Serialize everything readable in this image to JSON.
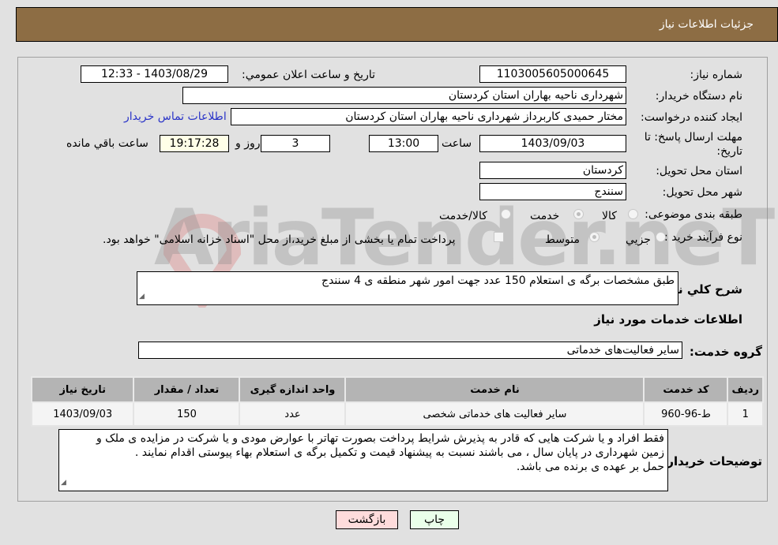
{
  "header": {
    "title": "جزئیات اطلاعات نیاز"
  },
  "fields": {
    "need_number_label": "شماره نیاز:",
    "need_number": "1103005605000645",
    "announce_label": "تاریخ و ساعت اعلان عمومي:",
    "announce_value": "1403/08/29 - 12:33",
    "buyer_org_label": "نام دستگاه خریدار:",
    "buyer_org": "شهرداری ناحیه بهاران استان کردستان",
    "requester_label": "ایجاد کننده درخواست:",
    "requester": "مختار حمیدی کاربرداز شهرداری ناحیه بهاران استان کردستان",
    "buyer_contact_link": "اطلاعات تماس خریدار",
    "deadline_label": "مهلت ارسال پاسخ: تا تاریخ:",
    "deadline_date": "1403/09/03",
    "time_label": "ساعت",
    "deadline_time": "13:00",
    "days_value": "3",
    "days_label": "روز و",
    "remaining_time": "19:17:28",
    "remaining_label": "ساعت باقي مانده",
    "province_label": "استان محل تحویل:",
    "province": "کردستان",
    "city_label": "شهر محل تحویل:",
    "city": "سنندج",
    "category_label": "طبقه بندی موضوعی:",
    "category_options": [
      {
        "label": "کالا",
        "selected": false
      },
      {
        "label": "خدمت",
        "selected": true
      },
      {
        "label": "کالا/خدمت",
        "selected": false
      }
    ],
    "process_label": "نوع فرآیند خرید :",
    "process_options": [
      {
        "label": "جزيي",
        "selected": false
      },
      {
        "label": "متوسط",
        "selected": true
      }
    ],
    "treasury_note": "پرداخت تمام یا بخشی از مبلغ خرید،از محل \"اسناد خزانه اسلامی\" خواهد بود.",
    "treasury_checked": false
  },
  "description": {
    "label": "شرح کلي نیاز:",
    "value": "طبق مشخصات برگه ی استعلام 150 عدد جهت امور شهر منطقه ی 4 سنندج"
  },
  "services": {
    "section_title": "اطلاعات خدمات مورد نیاز",
    "group_label": "گروه خدمت:",
    "group_value": "سایر فعالیت‌های خدماتی",
    "table": {
      "headers": [
        "ردیف",
        "کد خدمت",
        "نام خدمت",
        "واحد اندازه گیری",
        "تعداد / مقدار",
        "تاریخ نیاز"
      ],
      "rows": [
        [
          "1",
          "ط-96-960",
          "سایر فعالیت های خدماتی شخصی",
          "عدد",
          "150",
          "1403/09/03"
        ]
      ]
    }
  },
  "buyer_notes": {
    "label": "توضیحات خریدار:",
    "lines": [
      "فقط افراد و یا شرکت هایی که قادر به پذیرش شرایط پرداخت بصورت تهاتر با عوارض مودی و یا شرکت در مزایده ی ملک و",
      "زمین شهرداری در پایان سال ، می باشند نسبت به پیشنهاد قیمت و تکمیل برگه ی استعلام بهاء پیوستی اقدام نمایند .",
      "حمل بر عهده ی برنده می باشد."
    ]
  },
  "buttons": {
    "print": "چاپ",
    "back": "بازگشت"
  },
  "watermark": {
    "text": "AriaTender.neT"
  },
  "colors": {
    "header_bg": "#8d6d44",
    "link": "#2a34c8",
    "back_bg": "#ffdcdc",
    "print_bg": "#eaffea",
    "remaining_bg": "#ffffe7"
  }
}
